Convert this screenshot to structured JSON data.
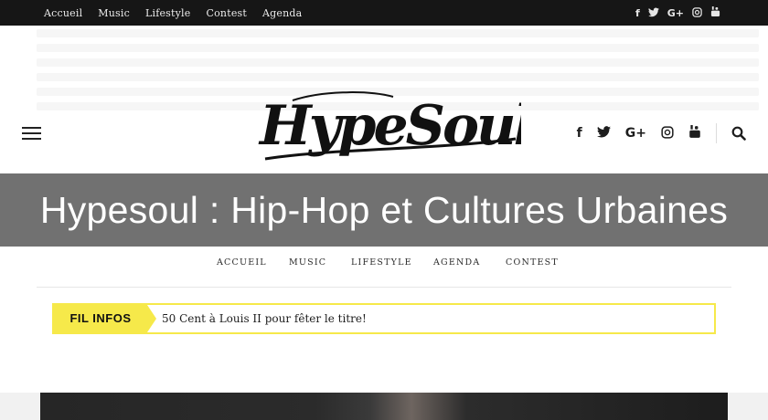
{
  "topbar": {
    "nav": [
      "Accueil",
      "Music",
      "Lifestyle",
      "Contest",
      "Agenda"
    ],
    "social_icons": [
      "facebook-icon",
      "twitter-icon",
      "google-plus-icon",
      "instagram-icon",
      "youtube-icon"
    ],
    "social_glyphs": [
      "f",
      "t",
      "G+",
      "◎",
      "▶"
    ]
  },
  "header": {
    "logo_text": "HypeSoul",
    "social_glyphs": [
      "f",
      "t",
      "G+",
      "◎",
      "▶"
    ]
  },
  "banner": {
    "title": "Hypesoul : Hip-Hop et Cultures Urbaines"
  },
  "main_nav": [
    "ACCUEIL",
    "MUSIC",
    "LIFESTYLE",
    "AGENDA",
    "CONTEST"
  ],
  "ticker": {
    "label": "FIL INFOS",
    "text": "50 Cent à Louis II pour fêter le titre!"
  },
  "colors": {
    "accent": "#f6e94a",
    "topbar": "#161616",
    "banner": "#6c6c6c"
  }
}
